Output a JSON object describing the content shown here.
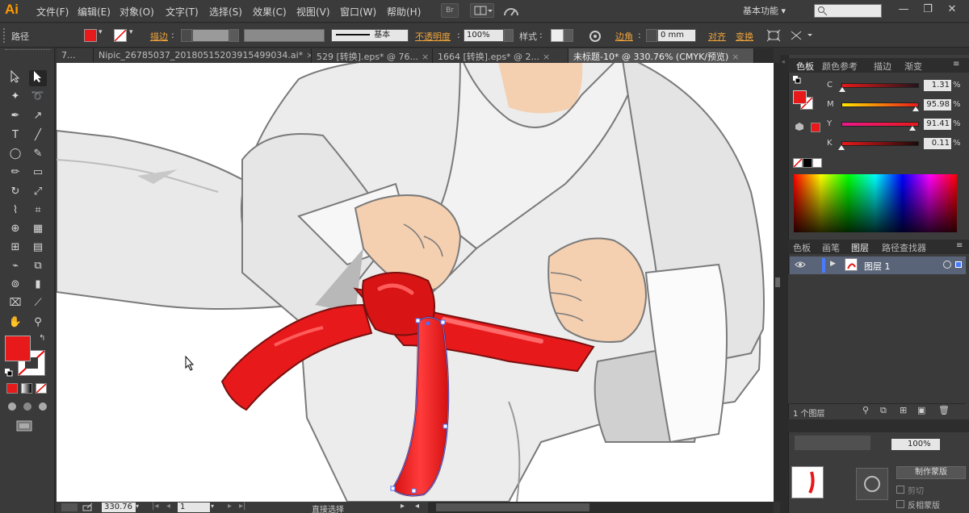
{
  "app": {
    "logo": "Ai",
    "workspace": "基本功能",
    "workspace_arrow": "▾"
  },
  "menu": [
    "文件(F)",
    "编辑(E)",
    "对象(O)",
    "文字(T)",
    "选择(S)",
    "效果(C)",
    "视图(V)",
    "窗口(W)",
    "帮助(H)"
  ],
  "menubar_icons": {
    "bridge": "Br",
    "arrange": "arrange-documents-icon",
    "gpu": "gpu-performance-icon"
  },
  "window_controls": {
    "minimize": "—",
    "restore": "❐",
    "close": "✕"
  },
  "control": {
    "object_type": "路径",
    "fill_color": "#e8191a",
    "stroke_label": "描边",
    "stroke_weight": "",
    "stroke_profile": "基本",
    "opacity_label": "不透明度",
    "opacity_value": "100%",
    "style_label": "样式",
    "corner_label": "边角",
    "corner_value": "0 mm",
    "align_label": "对齐",
    "transform_label": "变换"
  },
  "tabs": [
    {
      "label": "7...",
      "active": false
    },
    {
      "label": "Nipic_26785037_20180515203915499034.ai*",
      "active": false
    },
    {
      "label": "529 [转换].eps* @ 76...",
      "active": false
    },
    {
      "label": "1664 [转换].eps* @ 2...",
      "active": false
    },
    {
      "label": "未标题-10* @ 330.76% (CMYK/预览)",
      "active": true
    }
  ],
  "tab_close": "×",
  "color_panel": {
    "tabs": [
      "色板",
      "颜色参考",
      "描边",
      "渐变"
    ],
    "channels": [
      {
        "label": "C",
        "value": "1.31",
        "fraction": 0.013
      },
      {
        "label": "M",
        "value": "95.98",
        "fraction": 0.96
      },
      {
        "label": "Y",
        "value": "91.41",
        "fraction": 0.914
      },
      {
        "label": "K",
        "value": "0.11",
        "fraction": 0.001
      }
    ],
    "percent": "%"
  },
  "layers_panel": {
    "tabs": [
      "色板",
      "画笔",
      "图层",
      "路径查找器"
    ],
    "layers": [
      {
        "name": "图层 1"
      }
    ],
    "footer": "1 个图层"
  },
  "transparency_panel": {
    "opacity": "100%",
    "make_mask": "制作蒙版",
    "clip": "剪切",
    "invert_mask": "反相蒙版"
  },
  "status": {
    "zoom": "330.76",
    "page": "1",
    "tool": "直接选择"
  },
  "colors": {
    "belt_red": "#e8191a",
    "gi_white": "#e9e9e9",
    "skin": "#f4cfb0",
    "ui_bg": "#323232",
    "accent_link": "#f0a43a"
  }
}
